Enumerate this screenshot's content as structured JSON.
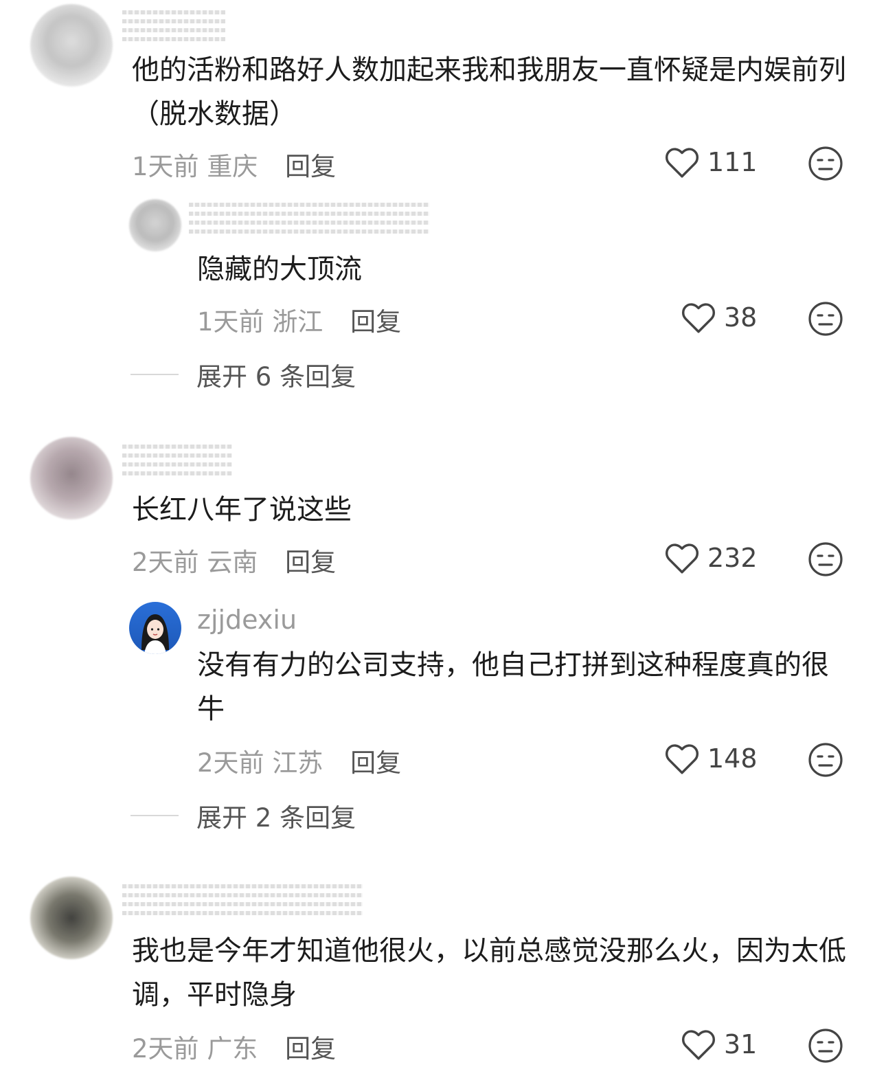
{
  "comments": [
    {
      "text": "他的活粉和路好人数加起来我和我朋友一直怀疑是内娱前列（脱水数据）",
      "time": "1天前",
      "location": "重庆",
      "reply_label": "回复",
      "likes": "111",
      "replies": [
        {
          "text": "隐藏的大顶流",
          "time": "1天前",
          "location": "浙江",
          "reply_label": "回复",
          "likes": "38"
        }
      ],
      "expand_label": "展开 6 条回复"
    },
    {
      "text": "长红八年了说这些",
      "time": "2天前",
      "location": "云南",
      "reply_label": "回复",
      "likes": "232",
      "replies": [
        {
          "username": "zjjdexiu",
          "text": "没有有力的公司支持，他自己打拼到这种程度真的很牛",
          "time": "2天前",
          "location": "江苏",
          "reply_label": "回复",
          "likes": "148"
        }
      ],
      "expand_label": "展开 2 条回复"
    },
    {
      "text": "我也是今年才知道他很火，以前总感觉没那么火，因为太低调，平时隐身",
      "time": "2天前",
      "location": "广东",
      "reply_label": "回复",
      "likes": "31"
    }
  ],
  "icons": {
    "like": "heart-outline-icon",
    "dislike": "neutral-face-icon"
  },
  "colors": {
    "meta_text": "#9a9a9a",
    "body_text": "#1c1c1c",
    "icon": "#444444"
  }
}
